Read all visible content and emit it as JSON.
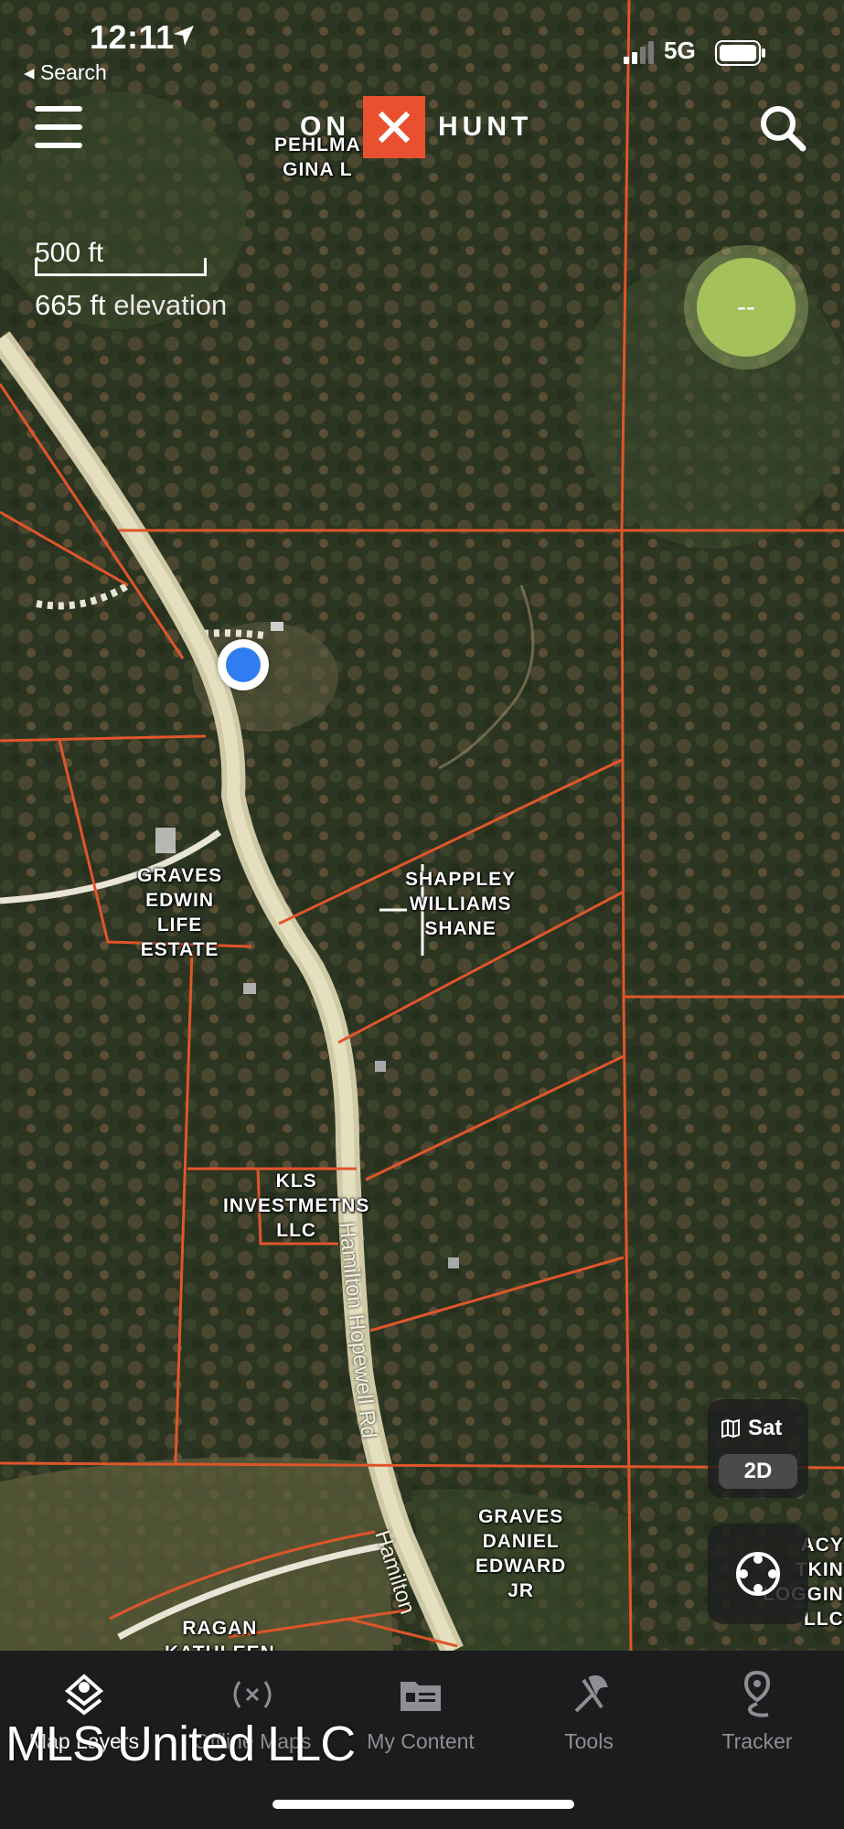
{
  "status_bar": {
    "time": "12:11",
    "network": "5G",
    "back_label": "Search"
  },
  "header": {
    "logo_left": "ON",
    "logo_right": "HUNT"
  },
  "map": {
    "scale_label": "500 ft",
    "elevation_value": "665 ft",
    "elevation_suffix": "elevation",
    "gps_accuracy": "--",
    "parcels": {
      "pehlman": "PEHLMA\nGINA L",
      "graves_edwin": "GRAVES\nEDWIN\nLIFE\nESTATE",
      "shappley": "SHAPPLEY\nWILLIAMS\nSHANE",
      "kls": "KLS\nINVESTMETNS\nLLC",
      "graves_daniel": "GRAVES\nDANIEL\nEDWARD\nJR",
      "ragan": "RAGAN\nKATHLEEN",
      "legacy": "ACY\nTKIN\nLOGGIN\nLLC"
    },
    "road_label_1": "Hamilton Hopewell Rd",
    "road_label_2": "Hamilton",
    "layer_type": "Sat",
    "view_mode": "2D"
  },
  "tabs": [
    {
      "label": "Map Layers",
      "icon": "layers-icon",
      "active": true
    },
    {
      "label": "Offline Maps",
      "icon": "offline-icon",
      "active": false
    },
    {
      "label": "My Content",
      "icon": "content-icon",
      "active": false
    },
    {
      "label": "Tools",
      "icon": "tools-icon",
      "active": false
    },
    {
      "label": "Tracker",
      "icon": "tracker-icon",
      "active": false
    }
  ],
  "watermark": "MLS United LLC",
  "colors": {
    "parcel_line": "#e0552b",
    "brand": "#e8502f",
    "location": "#2f7df0",
    "gps": "#a4c15a"
  }
}
